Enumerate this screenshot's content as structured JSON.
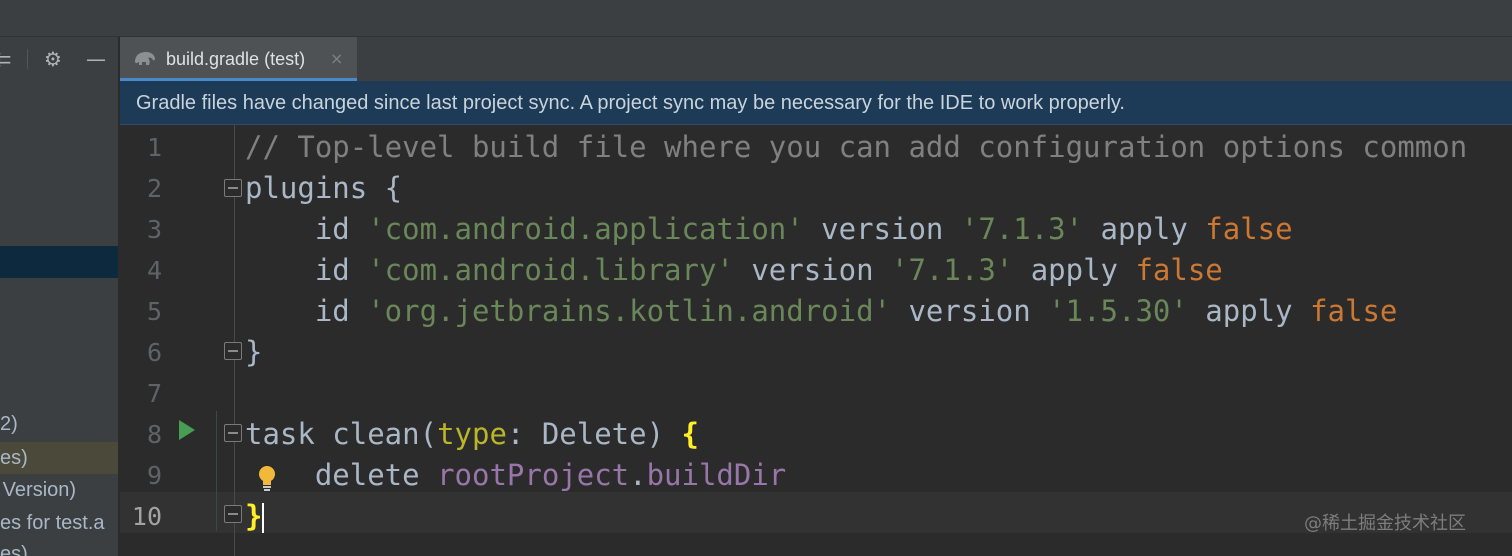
{
  "tab": {
    "title": "build.gradle (test)",
    "close_glyph": "×",
    "icon": "gradle-elephant-icon"
  },
  "banner": {
    "message": "Gradle files have changed since last project sync. A project sync may be necessary for the IDE to work properly."
  },
  "sidebar": {
    "items": [
      {
        "text": "2)"
      },
      {
        "text": "es)"
      },
      {
        "text": "e Version)"
      },
      {
        "text": "es for test.a"
      },
      {
        "text": "es)"
      }
    ]
  },
  "editor": {
    "line_numbers": [
      "1",
      "2",
      "3",
      "4",
      "5",
      "6",
      "7",
      "8",
      "9",
      "10"
    ],
    "current_line": "10",
    "lines": [
      {
        "tokens": [
          {
            "t": "// Top-level build file where you can add configuration options common",
            "c": "c-comment"
          }
        ]
      },
      {
        "tokens": [
          {
            "t": "plugins {",
            "c": ""
          }
        ]
      },
      {
        "tokens": [
          {
            "t": "    id ",
            "c": ""
          },
          {
            "t": "'com.android.application'",
            "c": "c-str"
          },
          {
            "t": " version ",
            "c": ""
          },
          {
            "t": "'7.1.3'",
            "c": "c-str"
          },
          {
            "t": " apply ",
            "c": ""
          },
          {
            "t": "false",
            "c": "c-kw"
          }
        ]
      },
      {
        "tokens": [
          {
            "t": "    id ",
            "c": ""
          },
          {
            "t": "'com.android.library'",
            "c": "c-str"
          },
          {
            "t": " version ",
            "c": ""
          },
          {
            "t": "'7.1.3'",
            "c": "c-str"
          },
          {
            "t": " apply ",
            "c": ""
          },
          {
            "t": "false",
            "c": "c-kw"
          }
        ]
      },
      {
        "tokens": [
          {
            "t": "    id ",
            "c": ""
          },
          {
            "t": "'org.jetbrains.kotlin.android'",
            "c": "c-str"
          },
          {
            "t": " version ",
            "c": ""
          },
          {
            "t": "'1.5.30'",
            "c": "c-str"
          },
          {
            "t": " apply ",
            "c": ""
          },
          {
            "t": "false",
            "c": "c-kw"
          }
        ]
      },
      {
        "tokens": [
          {
            "t": "}",
            "c": ""
          }
        ]
      },
      {
        "tokens": []
      },
      {
        "tokens": [
          {
            "t": "task clean(",
            "c": ""
          },
          {
            "t": "type",
            "c": "c-type"
          },
          {
            "t": ": Delete) ",
            "c": ""
          },
          {
            "t": "{",
            "c": "brace-match"
          }
        ]
      },
      {
        "tokens": [
          {
            "t": "    delete ",
            "c": ""
          },
          {
            "t": "rootProject",
            "c": "c-field"
          },
          {
            "t": ".",
            "c": ""
          },
          {
            "t": "buildDir",
            "c": "c-field"
          }
        ]
      },
      {
        "tokens": [
          {
            "t": "}",
            "c": "brace-match"
          }
        ]
      }
    ]
  },
  "watermark": "@稀土掘金技术社区",
  "colors": {
    "accent": "#4a88c7",
    "banner_bg": "#1d3b56",
    "editor_bg": "#2b2b2b",
    "run": "#499c54"
  }
}
